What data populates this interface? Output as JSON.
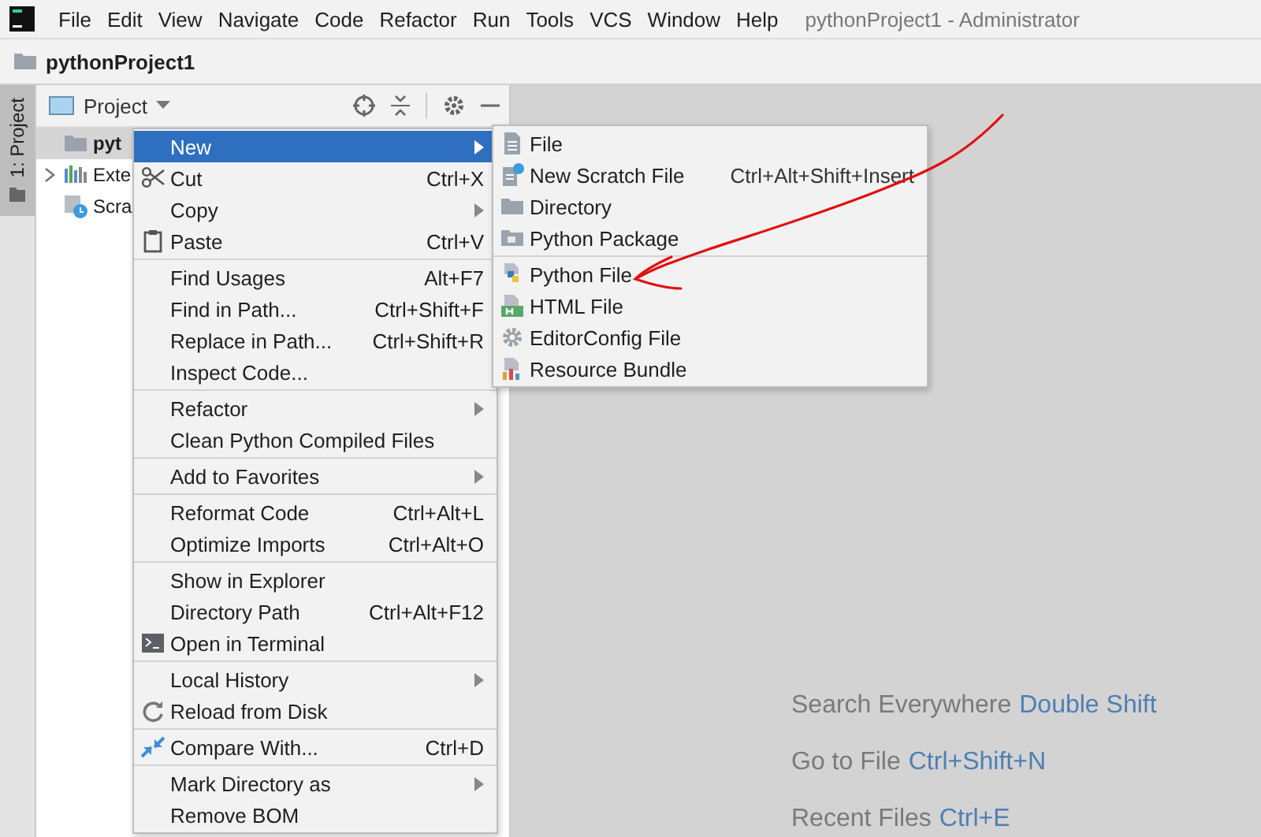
{
  "menubar": {
    "items": [
      "File",
      "Edit",
      "View",
      "Navigate",
      "Code",
      "Refactor",
      "Run",
      "Tools",
      "VCS",
      "Window",
      "Help"
    ],
    "title": "pythonProject1 - Administrator"
  },
  "breadcrumb": "pythonProject1",
  "tool_strip": {
    "tabs": [
      {
        "label": "1: Project",
        "selected": true
      }
    ]
  },
  "project_panel": {
    "title": "Project",
    "tree": [
      {
        "label": "pyt",
        "selected": true,
        "kind": "folder"
      },
      {
        "label": "Exte",
        "selected": false,
        "kind": "library",
        "expandable": true
      },
      {
        "label": "Scra",
        "selected": false,
        "kind": "scratch"
      }
    ]
  },
  "context_menu": {
    "groups": [
      [
        {
          "label": "New",
          "selected": true,
          "submenu": true
        },
        {
          "label": "Cut",
          "shortcut": "Ctrl+X",
          "kind": "scissors",
          "selected": false
        },
        {
          "label": "Copy",
          "submenu": true,
          "selected": false
        },
        {
          "label": "Paste",
          "shortcut": "Ctrl+V",
          "kind": "clipboard",
          "selected": false
        }
      ],
      [
        {
          "label": "Find Usages",
          "shortcut": "Alt+F7",
          "selected": false
        },
        {
          "label": "Find in Path...",
          "shortcut": "Ctrl+Shift+F",
          "selected": false
        },
        {
          "label": "Replace in Path...",
          "shortcut": "Ctrl+Shift+R",
          "selected": false
        },
        {
          "label": "Inspect Code...",
          "selected": false
        }
      ],
      [
        {
          "label": "Refactor",
          "submenu": true,
          "selected": false
        },
        {
          "label": "Clean Python Compiled Files",
          "selected": false
        }
      ],
      [
        {
          "label": "Add to Favorites",
          "submenu": true,
          "selected": false
        }
      ],
      [
        {
          "label": "Reformat Code",
          "shortcut": "Ctrl+Alt+L",
          "selected": false
        },
        {
          "label": "Optimize Imports",
          "shortcut": "Ctrl+Alt+O",
          "selected": false
        }
      ],
      [
        {
          "label": "Show in Explorer",
          "selected": false
        },
        {
          "label": "Directory Path",
          "shortcut": "Ctrl+Alt+F12",
          "selected": false
        },
        {
          "label": "Open in Terminal",
          "kind": "terminal",
          "selected": false
        }
      ],
      [
        {
          "label": "Local History",
          "submenu": true,
          "selected": false
        },
        {
          "label": "Reload from Disk",
          "kind": "reload",
          "selected": false
        }
      ],
      [
        {
          "label": "Compare With...",
          "shortcut": "Ctrl+D",
          "kind": "compare",
          "selected": false
        }
      ],
      [
        {
          "label": "Mark Directory as",
          "submenu": true,
          "selected": false
        },
        {
          "label": "Remove BOM",
          "selected": false
        }
      ]
    ]
  },
  "submenu": {
    "groups": [
      [
        {
          "label": "File",
          "kind": "file"
        },
        {
          "label": "New Scratch File",
          "shortcut": "Ctrl+Alt+Shift+Insert",
          "kind": "scratch-file"
        },
        {
          "label": "Directory",
          "kind": "folder"
        },
        {
          "label": "Python Package",
          "kind": "package"
        }
      ],
      [
        {
          "label": "Python File",
          "kind": "python"
        },
        {
          "label": "HTML File",
          "kind": "html"
        },
        {
          "label": "EditorConfig File",
          "kind": "gear"
        },
        {
          "label": "Resource Bundle",
          "kind": "bundle"
        }
      ]
    ]
  },
  "hints": [
    {
      "label": "Search Everywhere",
      "shortcut": "Double Shift"
    },
    {
      "label": "Go to File",
      "shortcut": "Ctrl+Shift+N"
    },
    {
      "label": "Recent Files",
      "shortcut": "Ctrl+E"
    }
  ],
  "annotations": [
    {
      "kind": "freehand-arrow"
    }
  ]
}
